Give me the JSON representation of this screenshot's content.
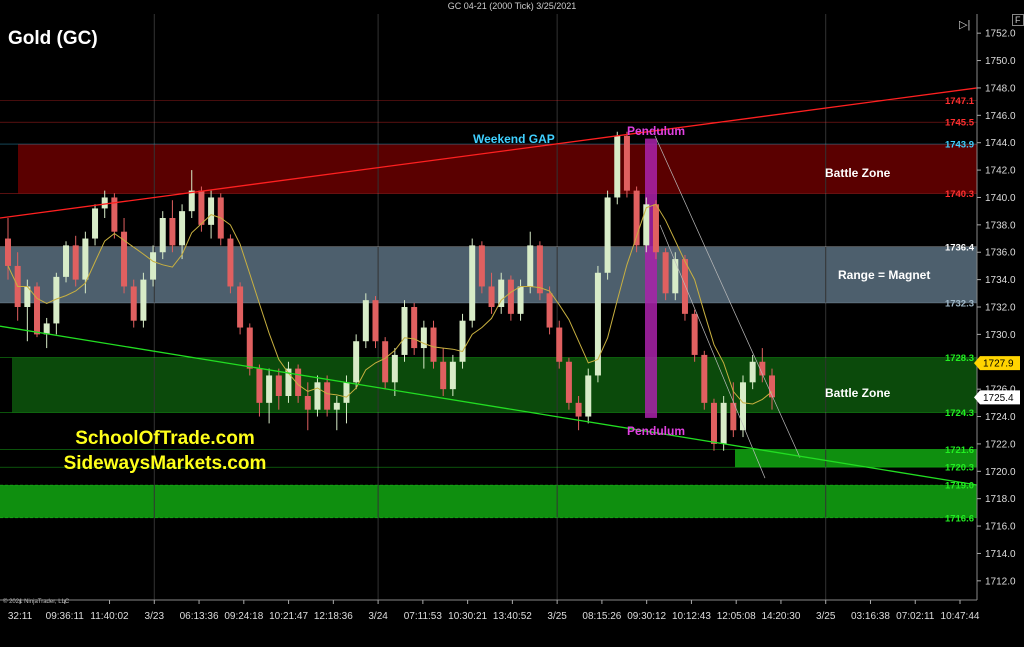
{
  "window": {
    "title": "GC 04-21 (2000 Tick)  3/25/2021",
    "copyright": "© 2021 NinjaTrader, LLC",
    "corner_button_1": "▷|",
    "corner_button_2": "F"
  },
  "branding": {
    "line1": "SchoolOfTrade.com",
    "line2": "SidewaysMarkets.com"
  },
  "colors": {
    "background": "#000000",
    "battle_zone_top": "#5a0000",
    "range_zone": "#5a7080",
    "battle_zone_mid": "#0b4a0b",
    "bright_green_zone": "#0f8f0f",
    "pendulum": "#aa22aa",
    "resistance_line": "#ff2020",
    "support_line": "#22dd22",
    "candle_up": "#d8ecc8",
    "candle_down": "#e06060",
    "moving_average": "#c8b040"
  },
  "chart_data": {
    "type": "candlestick",
    "title": "Gold (GC)",
    "instrument": "GC 04-21",
    "interval": "2000 Tick",
    "ylim": [
      1710.6,
      1753.4
    ],
    "y_ticks": [
      1712.0,
      1714.0,
      1716.0,
      1718.0,
      1720.0,
      1722.0,
      1724.0,
      1726.0,
      1728.0,
      1730.0,
      1732.0,
      1734.0,
      1736.0,
      1738.0,
      1740.0,
      1742.0,
      1744.0,
      1746.0,
      1748.0,
      1750.0,
      1752.0
    ],
    "x_tick_labels": [
      "32:11",
      "09:36:11",
      "11:40:02",
      "3/23",
      "06:13:36",
      "09:24:18",
      "10:21:47",
      "12:18:36",
      "3/24",
      "07:11:53",
      "10:30:21",
      "13:40:52",
      "3/25",
      "08:15:26",
      "09:30:12",
      "10:12:43",
      "12:05:08",
      "14:20:30",
      "3/25",
      "03:16:38",
      "07:02:11",
      "10:47:44"
    ],
    "session_dividers": [
      "3/23",
      "3/24",
      "3/25"
    ],
    "price_levels": [
      {
        "label": "1747.1",
        "value": 1747.1,
        "color": "#ff3030",
        "boxed": false
      },
      {
        "label": "1745.5",
        "value": 1745.5,
        "color": "#ff3030",
        "boxed": false
      },
      {
        "label": "1743.9",
        "value": 1743.9,
        "color": "#40d0ff",
        "boxed": false
      },
      {
        "label": "1740.3",
        "value": 1740.3,
        "color": "#ff3030",
        "boxed": false
      },
      {
        "label": "1736.4",
        "value": 1736.4,
        "color": "#ffffff",
        "boxed": false
      },
      {
        "label": "1732.3",
        "value": 1732.3,
        "color": "#a0b8c8",
        "boxed": false
      },
      {
        "label": "1728.3",
        "value": 1728.3,
        "color": "#22ee22",
        "boxed": false
      },
      {
        "label": "1724.3",
        "value": 1724.3,
        "color": "#22ee22",
        "boxed": false
      },
      {
        "label": "1721.6",
        "value": 1721.6,
        "color": "#22ee22",
        "boxed": false
      },
      {
        "label": "1720.3",
        "value": 1720.3,
        "color": "#22ee22",
        "boxed": false
      },
      {
        "label": "1719.0",
        "value": 1719.0,
        "color": "#22ee22",
        "boxed": false
      },
      {
        "label": "1716.6",
        "value": 1716.6,
        "color": "#22ee22",
        "boxed": false
      }
    ],
    "current_price_tags": [
      {
        "label": "1727.9",
        "value": 1727.9,
        "fill": "#ffd400",
        "text_color": "#000000"
      },
      {
        "label": "1725.4",
        "value": 1725.4,
        "fill": "#ffffff",
        "text_color": "#000000"
      }
    ],
    "zones": [
      {
        "name": "Battle Zone",
        "low": 1740.3,
        "high": 1743.9,
        "color": "#5a0000"
      },
      {
        "name": "Range = Magnet",
        "low": 1732.3,
        "high": 1736.4,
        "color": "#5a7080"
      },
      {
        "name": "Battle Zone",
        "low": 1724.3,
        "high": 1728.3,
        "color": "#0b4a0b"
      },
      {
        "name": "",
        "low": 1720.3,
        "high": 1721.6,
        "color": "#0f8f0f"
      },
      {
        "name": "",
        "low": 1716.6,
        "high": 1719.0,
        "color": "#0f8f0f"
      }
    ],
    "annotations": [
      {
        "text": "Weekend GAP",
        "color": "#40d0ff"
      },
      {
        "text": "Pendulum",
        "color": "#e040e0"
      },
      {
        "text": "Pendulum",
        "color": "#e040e0"
      }
    ],
    "trendlines": [
      {
        "name": "resistance",
        "from": [
          0,
          1738.5
        ],
        "to": [
          1,
          1748.0
        ],
        "color": "#ff2020"
      },
      {
        "name": "support",
        "from": [
          0,
          1730.6
        ],
        "to": [
          1,
          1719.0
        ],
        "color": "#22dd22"
      }
    ],
    "candles": [
      [
        1737.0,
        1738.5,
        1734.0,
        1735.0
      ],
      [
        1735.0,
        1736.0,
        1731.0,
        1732.0
      ],
      [
        1732.0,
        1734.0,
        1729.5,
        1733.5
      ],
      [
        1733.5,
        1733.8,
        1729.8,
        1730.0
      ],
      [
        1730.0,
        1731.2,
        1729.0,
        1730.8
      ],
      [
        1730.8,
        1734.5,
        1730.0,
        1734.2
      ],
      [
        1734.2,
        1736.8,
        1733.8,
        1736.5
      ],
      [
        1736.5,
        1737.2,
        1733.5,
        1734.0
      ],
      [
        1734.0,
        1737.5,
        1733.0,
        1737.0
      ],
      [
        1737.0,
        1739.5,
        1736.5,
        1739.2
      ],
      [
        1739.2,
        1740.5,
        1738.5,
        1740.0
      ],
      [
        1740.0,
        1740.3,
        1737.0,
        1737.5
      ],
      [
        1737.5,
        1738.5,
        1733.0,
        1733.5
      ],
      [
        1733.5,
        1734.0,
        1730.5,
        1731.0
      ],
      [
        1731.0,
        1734.5,
        1730.5,
        1734.0
      ],
      [
        1734.0,
        1736.5,
        1733.5,
        1736.0
      ],
      [
        1736.0,
        1739.0,
        1735.5,
        1738.5
      ],
      [
        1738.5,
        1739.8,
        1736.0,
        1736.5
      ],
      [
        1736.5,
        1739.5,
        1735.5,
        1739.0
      ],
      [
        1739.0,
        1742.0,
        1738.5,
        1740.5
      ],
      [
        1740.5,
        1740.8,
        1737.5,
        1738.0
      ],
      [
        1738.0,
        1740.5,
        1737.0,
        1740.0
      ],
      [
        1740.0,
        1740.3,
        1736.5,
        1737.0
      ],
      [
        1737.0,
        1737.3,
        1733.0,
        1733.5
      ],
      [
        1733.5,
        1733.8,
        1730.0,
        1730.5
      ],
      [
        1730.5,
        1730.8,
        1727.0,
        1727.5
      ],
      [
        1727.5,
        1727.8,
        1724.0,
        1725.0
      ],
      [
        1725.0,
        1727.5,
        1723.5,
        1727.0
      ],
      [
        1727.0,
        1727.5,
        1724.5,
        1725.5
      ],
      [
        1725.5,
        1728.0,
        1725.0,
        1727.5
      ],
      [
        1727.5,
        1727.8,
        1725.0,
        1725.5
      ],
      [
        1725.5,
        1726.5,
        1723.0,
        1724.5
      ],
      [
        1724.5,
        1727.0,
        1724.0,
        1726.5
      ],
      [
        1726.5,
        1727.0,
        1724.0,
        1724.5
      ],
      [
        1724.5,
        1725.5,
        1723.0,
        1725.0
      ],
      [
        1725.0,
        1727.0,
        1723.5,
        1726.5
      ],
      [
        1726.5,
        1730.0,
        1726.0,
        1729.5
      ],
      [
        1729.5,
        1733.0,
        1729.0,
        1732.5
      ],
      [
        1732.5,
        1732.8,
        1729.0,
        1729.5
      ],
      [
        1729.5,
        1729.8,
        1726.0,
        1726.5
      ],
      [
        1726.5,
        1729.0,
        1725.5,
        1728.5
      ],
      [
        1728.5,
        1732.5,
        1728.0,
        1732.0
      ],
      [
        1732.0,
        1732.3,
        1728.5,
        1729.0
      ],
      [
        1729.0,
        1731.0,
        1727.5,
        1730.5
      ],
      [
        1730.5,
        1731.0,
        1727.5,
        1728.0
      ],
      [
        1728.0,
        1729.0,
        1725.5,
        1726.0
      ],
      [
        1726.0,
        1728.5,
        1725.5,
        1728.0
      ],
      [
        1728.0,
        1731.5,
        1727.5,
        1731.0
      ],
      [
        1731.0,
        1737.0,
        1730.5,
        1736.5
      ],
      [
        1736.5,
        1736.8,
        1733.0,
        1733.5
      ],
      [
        1733.5,
        1734.5,
        1731.5,
        1732.0
      ],
      [
        1732.0,
        1734.5,
        1731.5,
        1734.0
      ],
      [
        1734.0,
        1734.3,
        1731.0,
        1731.5
      ],
      [
        1731.5,
        1734.0,
        1731.0,
        1733.5
      ],
      [
        1733.5,
        1737.5,
        1733.0,
        1736.5
      ],
      [
        1736.5,
        1736.8,
        1732.5,
        1733.0
      ],
      [
        1733.0,
        1733.5,
        1730.0,
        1730.5
      ],
      [
        1730.5,
        1731.0,
        1727.5,
        1728.0
      ],
      [
        1728.0,
        1728.3,
        1724.5,
        1725.0
      ],
      [
        1725.0,
        1725.5,
        1723.0,
        1724.0
      ],
      [
        1724.0,
        1727.5,
        1723.5,
        1727.0
      ],
      [
        1727.0,
        1735.0,
        1726.5,
        1734.5
      ],
      [
        1734.5,
        1740.5,
        1734.0,
        1740.0
      ],
      [
        1740.0,
        1744.8,
        1739.5,
        1744.5
      ],
      [
        1744.5,
        1744.8,
        1740.0,
        1740.5
      ],
      [
        1740.5,
        1740.8,
        1736.0,
        1736.5
      ],
      [
        1736.5,
        1740.0,
        1736.0,
        1739.5
      ],
      [
        1739.5,
        1739.8,
        1735.5,
        1736.0
      ],
      [
        1736.0,
        1736.3,
        1732.5,
        1733.0
      ],
      [
        1733.0,
        1736.0,
        1732.5,
        1735.5
      ],
      [
        1735.5,
        1735.8,
        1731.0,
        1731.5
      ],
      [
        1731.5,
        1731.8,
        1728.0,
        1728.5
      ],
      [
        1728.5,
        1728.8,
        1724.5,
        1725.0
      ],
      [
        1725.0,
        1725.3,
        1721.5,
        1722.0
      ],
      [
        1722.0,
        1725.5,
        1721.5,
        1725.0
      ],
      [
        1725.0,
        1726.5,
        1722.5,
        1723.0
      ],
      [
        1723.0,
        1727.0,
        1722.5,
        1726.5
      ],
      [
        1726.5,
        1728.5,
        1726.0,
        1728.0
      ],
      [
        1728.0,
        1729.0,
        1726.5,
        1727.0
      ],
      [
        1727.0,
        1727.5,
        1724.5,
        1725.4
      ]
    ],
    "moving_average_color": "#c8b040"
  }
}
